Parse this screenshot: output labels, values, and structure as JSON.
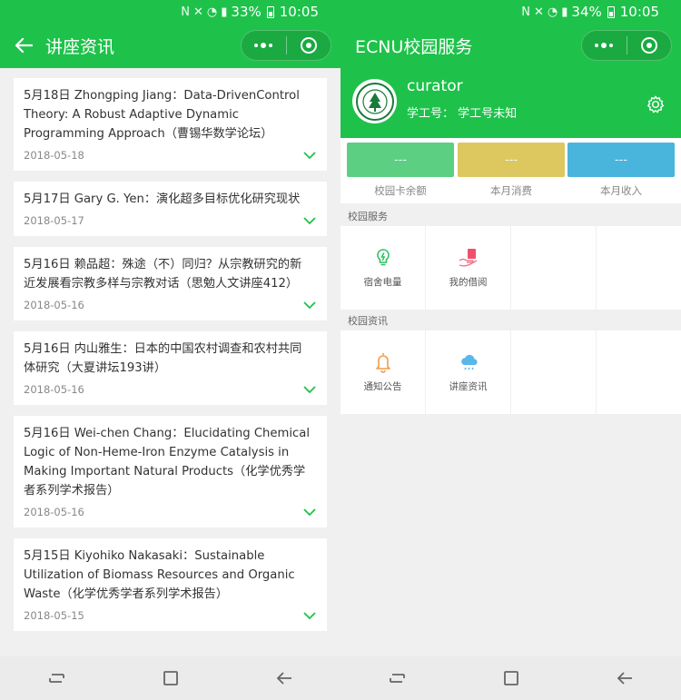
{
  "left": {
    "status": {
      "battery": "33%",
      "time": "10:05"
    },
    "title": "讲座资讯",
    "lectures": [
      {
        "title": "5月18日 Zhongping Jiang：Data-DrivenControl Theory: A Robust Adaptive Dynamic Programming Approach（曹锡华数学论坛）",
        "date": "2018-05-18"
      },
      {
        "title": "5月17日 Gary G. Yen：演化超多目标优化研究现状",
        "date": "2018-05-17"
      },
      {
        "title": "5月16日 赖品超：殊途（不）同归？从宗教研究的新近发展看宗教多样与宗教对话（思勉人文讲座412）",
        "date": "2018-05-16"
      },
      {
        "title": "5月16日 内山雅生：日本的中国农村调查和农村共同体研究（大夏讲坛193讲）",
        "date": "2018-05-16"
      },
      {
        "title": "5月16日 Wei-chen Chang：Elucidating Chemical Logic of Non-Heme-Iron Enzyme Catalysis in Making Important Natural Products（化学优秀学者系列学术报告）",
        "date": "2018-05-16"
      },
      {
        "title": "5月15日 Kiyohiko Nakasaki：Sustainable Utilization of Biomass Resources and Organic Waste（化学优秀学者系列学术报告）",
        "date": "2018-05-15"
      }
    ]
  },
  "right": {
    "status": {
      "battery": "34%",
      "time": "10:05"
    },
    "title": "ECNU校园服务",
    "profile": {
      "username": "curator",
      "id_label": "学工号：",
      "id_value": "学工号未知"
    },
    "stats": [
      {
        "value": "---",
        "label": "校园卡余额",
        "color": "#5ccf83"
      },
      {
        "value": "---",
        "label": "本月消费",
        "color": "#ddc85f"
      },
      {
        "value": "---",
        "label": "本月收入",
        "color": "#4ab5dc"
      }
    ],
    "section_services": "校园服务",
    "services": [
      {
        "label": "宿舍电量",
        "icon": "bulb-icon"
      },
      {
        "label": "我的借阅",
        "icon": "book-hand-icon"
      }
    ],
    "section_news": "校园资讯",
    "news": [
      {
        "label": "通知公告",
        "icon": "bell-icon"
      },
      {
        "label": "讲座资讯",
        "icon": "cloud-icon"
      }
    ]
  },
  "colors": {
    "brand_green": "#1ec24a",
    "chevron_green": "#1ec24a"
  }
}
